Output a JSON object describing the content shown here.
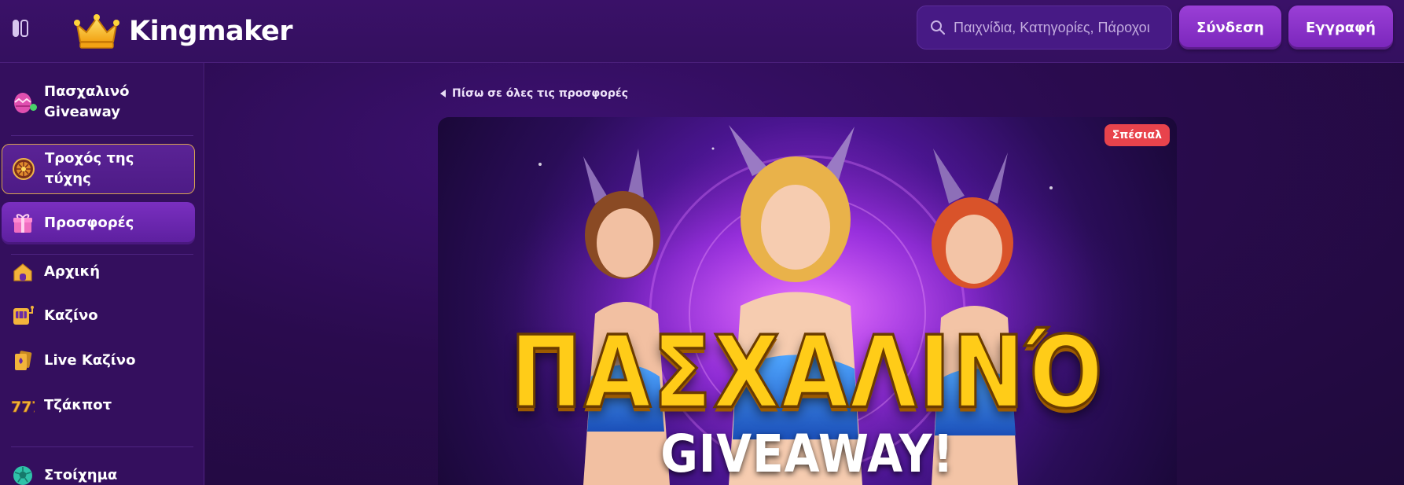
{
  "header": {
    "brand": "Kingmaker",
    "search_placeholder": "Παιχνίδια, Κατηγορίες, Πάροχοι",
    "login_label": "Σύνδεση",
    "register_label": "Εγγραφή"
  },
  "sidebar": {
    "items": [
      {
        "label": "Πασχαλινό Giveaway",
        "icon": "easter-egg-icon"
      },
      {
        "label": "Τροχός της τύχης",
        "icon": "wheel-of-fortune-icon"
      },
      {
        "label": "Προσφορές",
        "icon": "gift-icon"
      },
      {
        "label": "Αρχική",
        "icon": "home-icon"
      },
      {
        "label": "Καζίνο",
        "icon": "slot-machine-icon"
      },
      {
        "label": "Live Καζίνο",
        "icon": "playing-card-icon"
      },
      {
        "label": "Τζάκποτ",
        "icon": "777-jackpot-icon"
      },
      {
        "label": "Στοίχημα",
        "icon": "soccer-ball-icon"
      }
    ]
  },
  "main": {
    "back_link": "Πίσω σε όλες τις προσφορές",
    "banner": {
      "badge": "Σπέσιαλ",
      "title": "ΠΑΣΧΑΛΙΝΌ",
      "subtitle": "GIVEAWAY!"
    }
  },
  "colors": {
    "background": "#2a0b4a",
    "sidebar": "#340f5e",
    "button": "#8a33c9",
    "badge": "#e8434c",
    "title_gold": "#ffcc18",
    "wheel_border": "#d6a350"
  }
}
